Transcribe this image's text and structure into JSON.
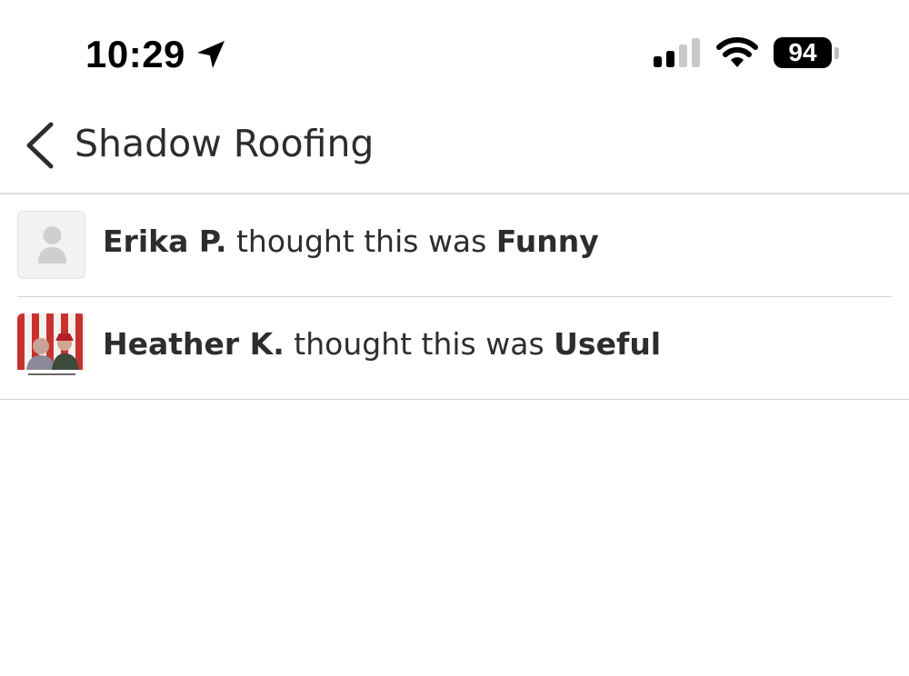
{
  "status_bar": {
    "time": "10:29",
    "battery": "94",
    "icons": [
      "location-arrow-icon",
      "cellular-signal-icon",
      "wifi-icon",
      "battery-icon"
    ]
  },
  "header": {
    "back_icon": "chevron-left-icon",
    "title": "Shadow Roofing"
  },
  "reactions": [
    {
      "name": "Erika P.",
      "middle": " thought this was ",
      "reaction": "Funny",
      "avatar": "default-user-avatar"
    },
    {
      "name": "Heather K.",
      "middle": " thought this was ",
      "reaction": "Useful",
      "avatar": "photo-avatar"
    }
  ],
  "colors": {
    "text": "#2d2d2d",
    "divider": "#d6d6d6",
    "background": "#ffffff"
  }
}
